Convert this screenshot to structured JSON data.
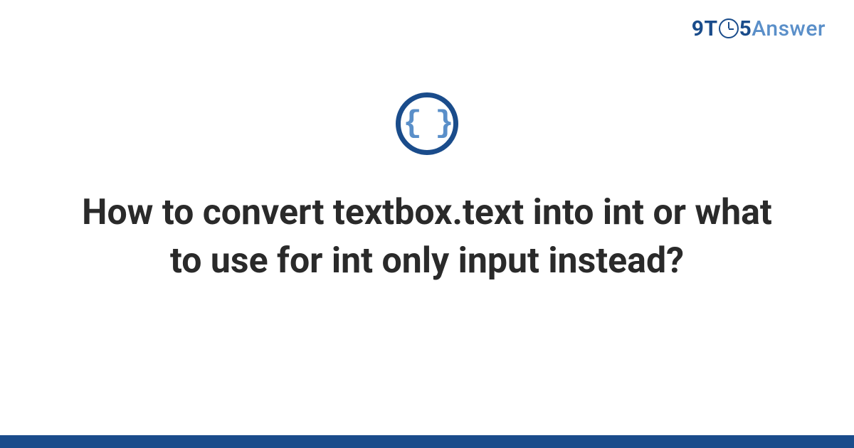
{
  "logo": {
    "part1": "9T",
    "part2": "5",
    "part3": "Answer"
  },
  "icon": {
    "name": "code-braces-icon",
    "glyph": "{ }"
  },
  "title": "How to convert textbox.text into int or what to use for int only input instead?",
  "colors": {
    "brand_dark": "#1a4c8b",
    "brand_light": "#5a8fc9",
    "text": "#2a2a2a"
  }
}
